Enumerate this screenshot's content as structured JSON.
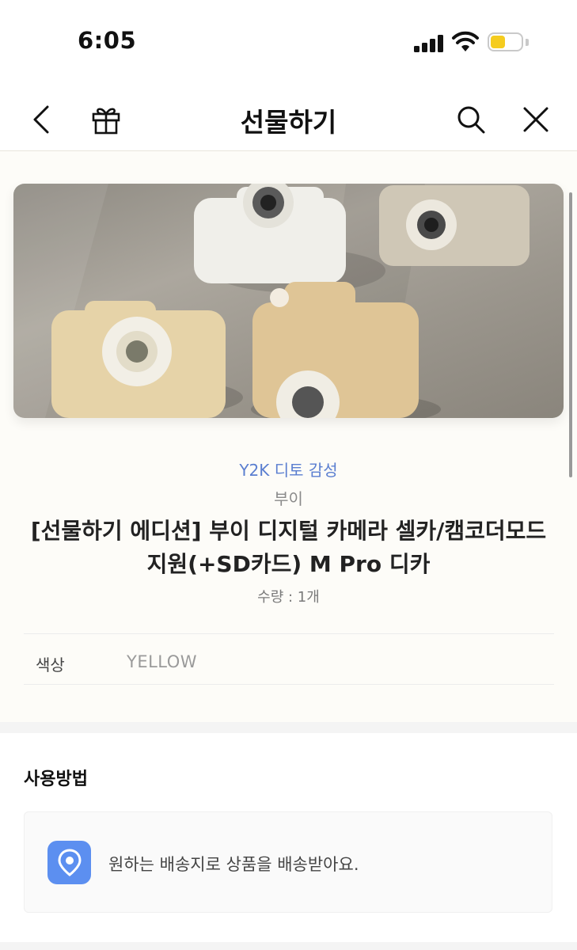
{
  "status_bar": {
    "time": "6:05",
    "signal_icon": "cellular-signal-icon",
    "wifi_icon": "wifi-icon",
    "battery_icon": "battery-icon",
    "battery_color": "#f5cc1f"
  },
  "nav": {
    "title": "선물하기",
    "back_icon": "chevron-left-icon",
    "gift_icon": "gift-icon",
    "search_icon": "search-icon",
    "close_icon": "close-icon"
  },
  "product": {
    "image_icon": "product-photo",
    "category": "Y2K 디토 감성",
    "brand": "부이",
    "title": "[선물하기 에디션] 부이 디지털 카메라 셀카/캠코더모드 지원(+SD카드) M Pro 디카",
    "quantity": "수량 : 1개",
    "option": {
      "label": "색상",
      "value": "YELLOW"
    }
  },
  "usage": {
    "title": "사용방법",
    "icon": "location-pin-icon",
    "text": "원하는 배송지로 상품을 배송받아요."
  },
  "colors": {
    "accent_blue": "#5a7ed0",
    "icon_blue": "#5c8ff0"
  }
}
